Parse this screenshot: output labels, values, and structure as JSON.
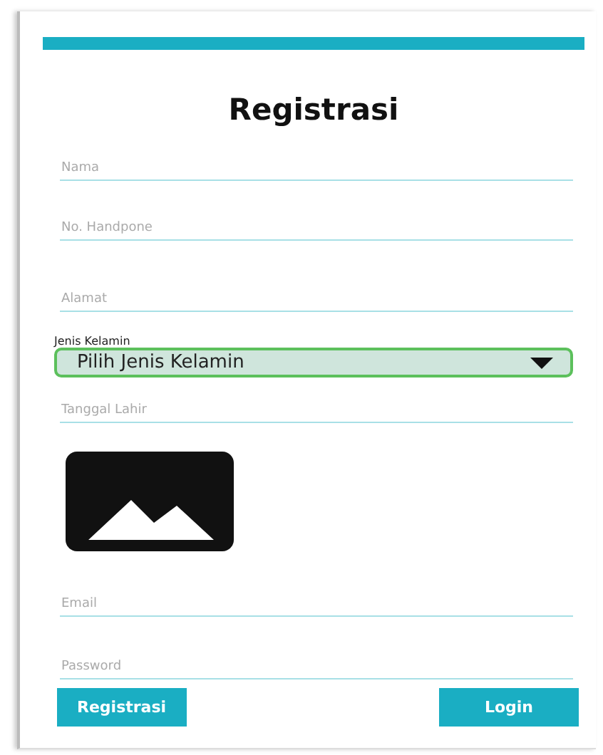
{
  "title": "Registrasi",
  "fields": [
    {
      "kind": "text",
      "placeholder": "Nama"
    },
    {
      "kind": "text",
      "placeholder": "No. Handpone"
    },
    {
      "kind": "text",
      "placeholder": "Alamat"
    },
    {
      "kind": "dropdown",
      "label": "Jenis Kelamin",
      "value": "Pilih Jenis Kelamin"
    },
    {
      "kind": "text",
      "placeholder": "Tanggal Lahir"
    },
    {
      "kind": "image"
    },
    {
      "kind": "text",
      "placeholder": "Email"
    },
    {
      "kind": "text",
      "placeholder": "Password"
    }
  ],
  "buttons": [
    "Registrasi",
    "Login"
  ]
}
